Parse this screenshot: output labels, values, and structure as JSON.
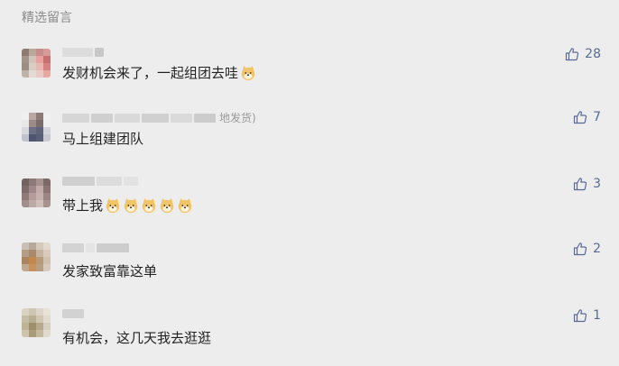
{
  "section_title": "精选留言",
  "colors": {
    "like": "#576b95",
    "text": "#222222",
    "muted": "#8a8a8a",
    "background": "#ededed"
  },
  "comments": [
    {
      "content": "发财机会来了，一起组团去哇",
      "emoji_count": 1,
      "likes": "28",
      "nick_suffix": ""
    },
    {
      "content": "马上组建团队",
      "emoji_count": 0,
      "likes": "7",
      "nick_suffix": "地发货)"
    },
    {
      "content": "带上我",
      "emoji_count": 5,
      "likes": "3",
      "nick_suffix": ""
    },
    {
      "content": "发家致富靠这单",
      "emoji_count": 0,
      "likes": "2",
      "nick_suffix": ""
    },
    {
      "content": "有机会，这几天我去逛逛",
      "emoji_count": 0,
      "likes": "1",
      "nick_suffix": ""
    }
  ]
}
